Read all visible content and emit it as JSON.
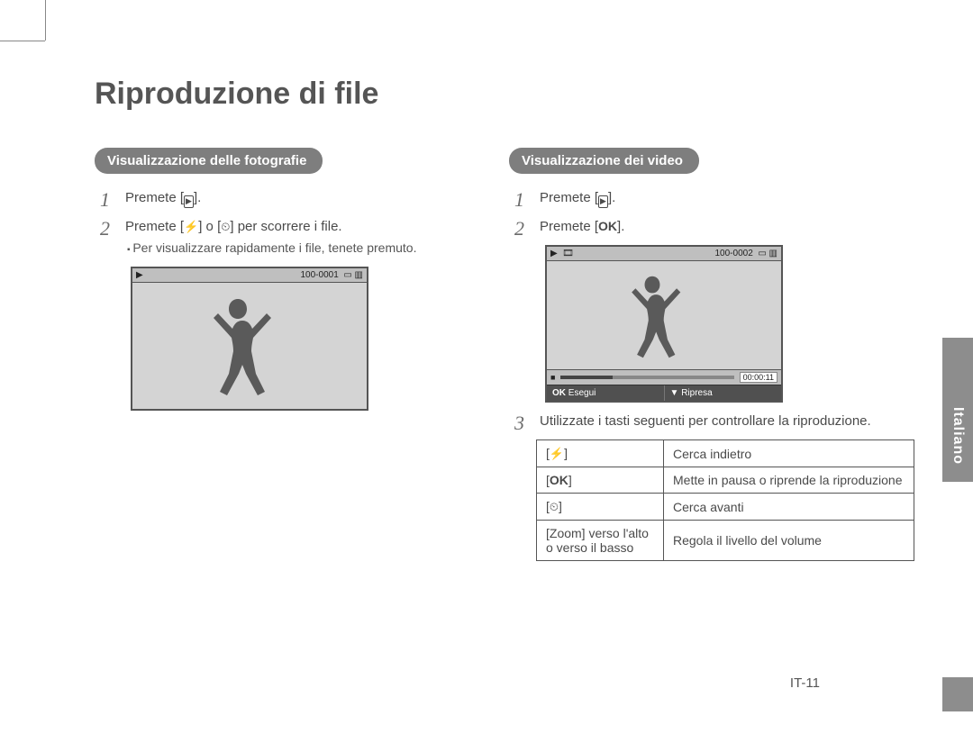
{
  "title": "Riproduzione di file",
  "language_tab": "Italiano",
  "page_number": "IT-11",
  "photos": {
    "heading": "Visualizzazione delle fotografie",
    "step1_prefix": "Premete [",
    "step1_suffix": "].",
    "step2_a": "Premete [",
    "step2_b": "] o [",
    "step2_c": "] per scorrere i file.",
    "sub": "Per visualizzare rapidamente i file, tenete premuto.",
    "shot": {
      "file_counter": "100-0001"
    }
  },
  "videos": {
    "heading": "Visualizzazione dei video",
    "step1_prefix": "Premete [",
    "step1_suffix": "].",
    "step2_prefix": "Premete [",
    "step2_label": "OK",
    "step2_suffix": "].",
    "step3": "Utilizzate i tasti seguenti per controllare la riproduzione.",
    "shot": {
      "file_counter": "100-0002",
      "time": "00:00:11",
      "bottom_left_label": "Esegui",
      "bottom_left_key": "OK",
      "bottom_right_label": "Ripresa",
      "bottom_right_key": "▼"
    },
    "controls": {
      "r1_desc": "Cerca indietro",
      "r2_key": "OK",
      "r2_desc": "Mette in pausa o riprende la riproduzione",
      "r3_desc": "Cerca avanti",
      "r4_key": "[Zoom] verso l'alto o verso il basso",
      "r4_desc": "Regola il livello del volume"
    }
  }
}
